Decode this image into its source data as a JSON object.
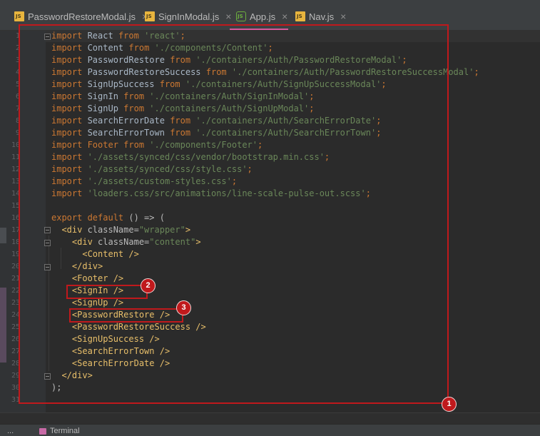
{
  "tabs": [
    {
      "label": "PasswordRestoreModal.js",
      "icon": "js-file-icon",
      "active": false
    },
    {
      "label": "SignInModal.js",
      "icon": "js-file-icon",
      "active": false
    },
    {
      "label": "App.js",
      "icon": "nodejs-file-icon",
      "active": true
    },
    {
      "label": "Nav.js",
      "icon": "js-file-icon",
      "active": false
    }
  ],
  "tab_close_glyph": "×",
  "line_numbers": [
    "1",
    "2",
    "3",
    "4",
    "5",
    "6",
    "7",
    "8",
    "9",
    "10",
    "11",
    "12",
    "13",
    "14",
    "15",
    "16",
    "17",
    "18",
    "19",
    "20",
    "21",
    "22",
    "23",
    "24",
    "25",
    "26",
    "27",
    "28",
    "29",
    "30",
    "31"
  ],
  "code_lines": [
    [
      {
        "t": "import",
        "c": "kw"
      },
      {
        "t": " React ",
        "c": "id"
      },
      {
        "t": "from",
        "c": "kw"
      },
      {
        "t": " 'react'",
        "c": "str"
      },
      {
        "t": ";",
        "c": "kw"
      }
    ],
    [
      {
        "t": "import",
        "c": "kw"
      },
      {
        "t": " Content ",
        "c": "id"
      },
      {
        "t": "from",
        "c": "kw"
      },
      {
        "t": " './components/Content'",
        "c": "str"
      },
      {
        "t": ";",
        "c": "kw"
      }
    ],
    [
      {
        "t": "import",
        "c": "kw"
      },
      {
        "t": " PasswordRestore ",
        "c": "id"
      },
      {
        "t": "from",
        "c": "kw"
      },
      {
        "t": " './containers/Auth/PasswordRestoreModal'",
        "c": "str"
      },
      {
        "t": ";",
        "c": "kw"
      }
    ],
    [
      {
        "t": "import",
        "c": "kw"
      },
      {
        "t": " PasswordRestoreSuccess ",
        "c": "id"
      },
      {
        "t": "from",
        "c": "kw"
      },
      {
        "t": " './containers/Auth/PasswordRestoreSuccessModal'",
        "c": "str"
      },
      {
        "t": ";",
        "c": "kw"
      }
    ],
    [
      {
        "t": "import",
        "c": "kw"
      },
      {
        "t": " SignUpSuccess ",
        "c": "id"
      },
      {
        "t": "from",
        "c": "kw"
      },
      {
        "t": " './containers/Auth/SignUpSuccessModal'",
        "c": "str"
      },
      {
        "t": ";",
        "c": "kw"
      }
    ],
    [
      {
        "t": "import",
        "c": "kw"
      },
      {
        "t": " SignIn ",
        "c": "id"
      },
      {
        "t": "from",
        "c": "kw"
      },
      {
        "t": " './containers/Auth/SignInModal'",
        "c": "str"
      },
      {
        "t": ";",
        "c": "kw"
      }
    ],
    [
      {
        "t": "import",
        "c": "kw"
      },
      {
        "t": " SignUp ",
        "c": "id"
      },
      {
        "t": "from",
        "c": "kw"
      },
      {
        "t": " './containers/Auth/SignUpModal'",
        "c": "str"
      },
      {
        "t": ";",
        "c": "kw"
      }
    ],
    [
      {
        "t": "import",
        "c": "kw"
      },
      {
        "t": " SearchErrorDate ",
        "c": "id"
      },
      {
        "t": "from",
        "c": "kw"
      },
      {
        "t": " './containers/Auth/SearchErrorDate'",
        "c": "str"
      },
      {
        "t": ";",
        "c": "kw"
      }
    ],
    [
      {
        "t": "import",
        "c": "kw"
      },
      {
        "t": " SearchErrorTown ",
        "c": "id"
      },
      {
        "t": "from",
        "c": "kw"
      },
      {
        "t": " './containers/Auth/SearchErrorTown'",
        "c": "str"
      },
      {
        "t": ";",
        "c": "kw"
      }
    ],
    [
      {
        "t": "import",
        "c": "kw"
      },
      {
        "t": " Footer ",
        "c": "kw"
      },
      {
        "t": "from",
        "c": "kw"
      },
      {
        "t": " './components/Footer'",
        "c": "str"
      },
      {
        "t": ";",
        "c": "kw"
      }
    ],
    [
      {
        "t": "import",
        "c": "kw"
      },
      {
        "t": " './assets/synced/css/vendor/bootstrap.min.css'",
        "c": "str"
      },
      {
        "t": ";",
        "c": "kw"
      }
    ],
    [
      {
        "t": "import",
        "c": "kw"
      },
      {
        "t": " './assets/synced/css/style.css'",
        "c": "str"
      },
      {
        "t": ";",
        "c": "kw"
      }
    ],
    [
      {
        "t": "import",
        "c": "kw"
      },
      {
        "t": " './assets/custom-styles.css'",
        "c": "str"
      },
      {
        "t": ";",
        "c": "kw"
      }
    ],
    [
      {
        "t": "import",
        "c": "kw"
      },
      {
        "t": " 'loaders.css/src/animations/line-scale-pulse-out.scss'",
        "c": "str"
      },
      {
        "t": ";",
        "c": "kw"
      }
    ],
    [],
    [
      {
        "t": "export default",
        "c": "kw"
      },
      {
        "t": " () => (",
        "c": "pl"
      }
    ],
    [
      {
        "t": "  <div ",
        "c": "tg"
      },
      {
        "t": "className=",
        "c": "at"
      },
      {
        "t": "\"wrapper\"",
        "c": "str"
      },
      {
        "t": ">",
        "c": "tg"
      }
    ],
    [
      {
        "t": "    <div ",
        "c": "tg"
      },
      {
        "t": "className=",
        "c": "at"
      },
      {
        "t": "\"content\"",
        "c": "str"
      },
      {
        "t": ">",
        "c": "tg"
      }
    ],
    [
      {
        "t": "      <Content />",
        "c": "tg"
      }
    ],
    [
      {
        "t": "    </div>",
        "c": "tg"
      }
    ],
    [
      {
        "t": "    <Footer />",
        "c": "tg"
      }
    ],
    [
      {
        "t": "    <SignIn />",
        "c": "tg"
      }
    ],
    [
      {
        "t": "    <SignUp />",
        "c": "tg"
      }
    ],
    [
      {
        "t": "    <PasswordRestore />",
        "c": "tg"
      }
    ],
    [
      {
        "t": "    <PasswordRestoreSuccess />",
        "c": "tg"
      }
    ],
    [
      {
        "t": "    <SignUpSuccess />",
        "c": "tg"
      }
    ],
    [
      {
        "t": "    <SearchErrorTown />",
        "c": "tg"
      }
    ],
    [
      {
        "t": "    <SearchErrorDate />",
        "c": "tg"
      }
    ],
    [
      {
        "t": "  </div>",
        "c": "tg"
      }
    ],
    [
      {
        "t": ");",
        "c": "pl"
      }
    ],
    []
  ],
  "annotations": [
    {
      "number": "1",
      "target": "whole code block"
    },
    {
      "number": "2",
      "target": "<SignIn />"
    },
    {
      "number": "3",
      "target": "<PasswordRestore />"
    }
  ],
  "status": {
    "left_text": "...",
    "terminal_label": "Terminal"
  },
  "colors": {
    "keyword": "#cc7832",
    "string": "#6a8759",
    "tag": "#e8bf6a",
    "identifier": "#a9b7c6",
    "annotation_red": "#c0191c",
    "active_tab_underline": "#d75a9c"
  }
}
